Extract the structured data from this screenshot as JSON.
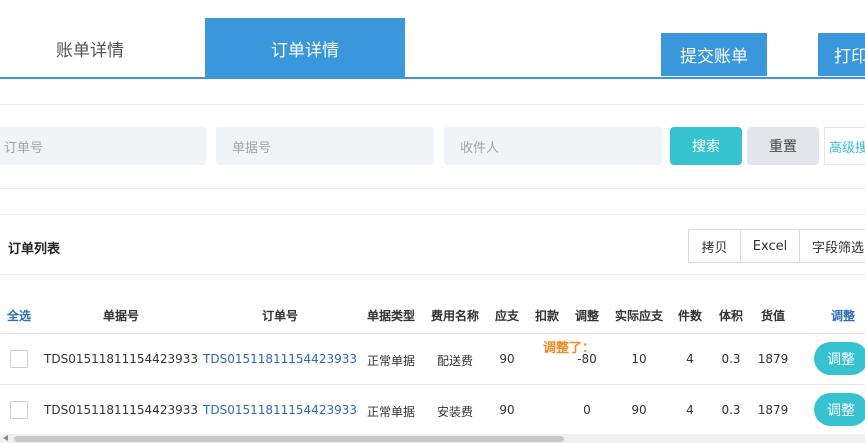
{
  "tabs": [
    {
      "label": "账单详情",
      "active": false
    },
    {
      "label": "订单详情",
      "active": true
    }
  ],
  "top_actions": {
    "submit_label": "提交账单",
    "print_label": "打印"
  },
  "search": {
    "order_placeholder": "订单号",
    "bill_placeholder": "单据号",
    "receiver_placeholder": "收件人",
    "search_label": "搜索",
    "reset_label": "重置",
    "advanced_label": "高级搜"
  },
  "list": {
    "title": "订单列表",
    "copy_label": "拷贝",
    "excel_label": "Excel",
    "field_filter_label": "字段筛选"
  },
  "table": {
    "columns": [
      "全选",
      "单据号",
      "订单号",
      "单据类型",
      "费用名称",
      "应支",
      "扣款",
      "调整",
      "实际应支",
      "件数",
      "体积",
      "货值",
      "调整"
    ],
    "adjust_note": "调整了：",
    "rows": [
      {
        "bill_no": "TDS01511811154423933",
        "order_no": "TDS01511811154423933",
        "type": "正常单据",
        "fee": "配送费",
        "payable": "90",
        "deduct": "",
        "adjust": "-80",
        "actual": "10",
        "pieces": "4",
        "volume": "0.3",
        "value": "1879",
        "action": "调整"
      },
      {
        "bill_no": "TDS01511811154423933",
        "order_no": "TDS01511811154423933",
        "type": "正常单据",
        "fee": "安装费",
        "payable": "90",
        "deduct": "",
        "adjust": "0",
        "actual": "90",
        "pieces": "4",
        "volume": "0.3",
        "value": "1879",
        "action": "调整"
      }
    ]
  },
  "colors": {
    "primary": "#3a97dc",
    "accent": "#36c2cf",
    "warning": "#f08a24"
  }
}
